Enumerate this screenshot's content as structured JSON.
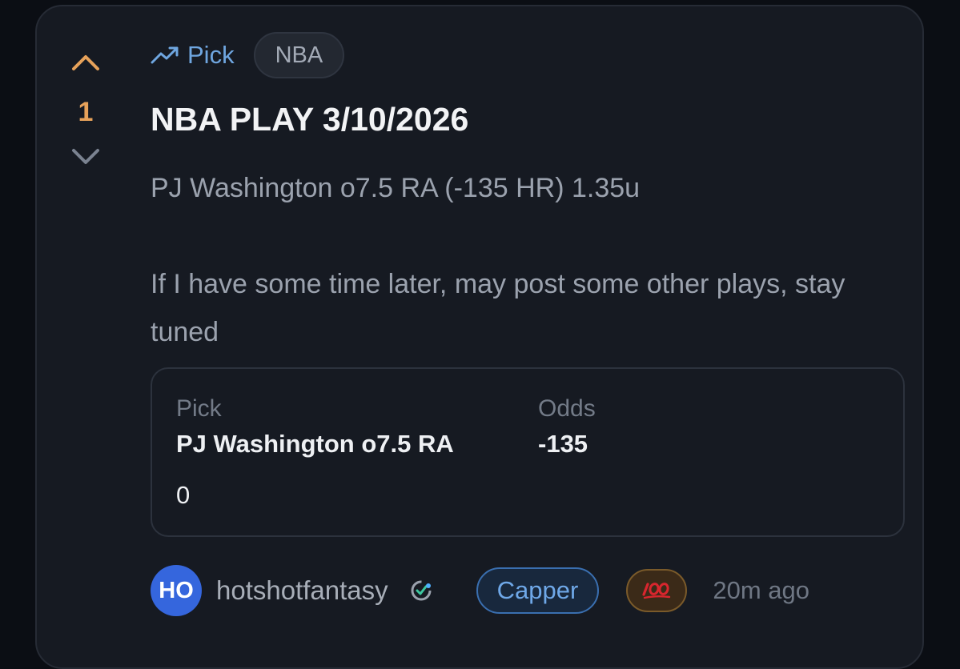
{
  "post": {
    "vote_count": "1",
    "type_label": "Pick",
    "league_tag": "NBA",
    "title": "NBA PLAY 3/10/2026",
    "body_line1": "PJ Washington o7.5 RA (-135 HR) 1.35u",
    "body_line2": "If I have some time later, may post some other plays, stay tuned"
  },
  "pick_card": {
    "pick_label": "Pick",
    "pick_value": "PJ Washington o7.5 RA",
    "odds_label": "Odds",
    "odds_value": "-135",
    "result_value": "0"
  },
  "author": {
    "initials": "HO",
    "username": "hotshotfantasy",
    "role": "Capper",
    "reaction_icon": "hundred-points-icon",
    "time_ago": "20m ago"
  },
  "colors": {
    "background": "#0b0e14",
    "card": "#161a22",
    "vote_accent": "#e7a25a",
    "link_blue": "#6fa6e0",
    "avatar_blue": "#3566dd"
  }
}
